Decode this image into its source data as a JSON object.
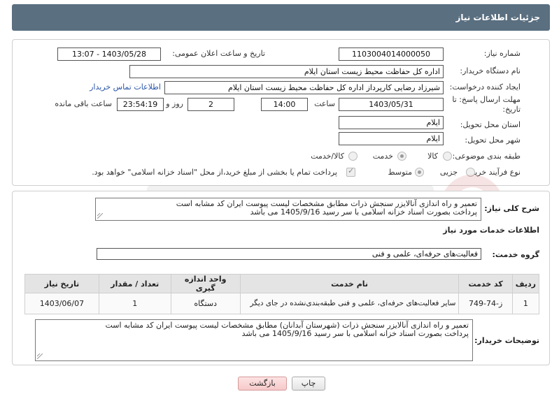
{
  "page": {
    "title": "جزئیات اطلاعات نیاز"
  },
  "form": {
    "need_number_label": "شماره نیاز:",
    "need_number": "1103004014000050",
    "announce_label": "تاریخ و ساعت اعلان عمومی:",
    "announce_value": "1403/05/28 - 13:07",
    "buyer_org_label": "نام دستگاه خریدار:",
    "buyer_org": "اداره کل حفاظت محیط زیست استان ایلام",
    "creator_label": "ایجاد کننده درخواست:",
    "creator": "شیرزاد رضایی کارپرداز اداره کل حفاظت محیط زیست استان ایلام",
    "contact_link": "اطلاعات تماس خریدار",
    "deadline_label": "مهلت ارسال پاسخ: تا تاریخ:",
    "deadline_date": "1403/05/31",
    "time_label": "ساعت",
    "deadline_time": "14:00",
    "days_value": "2",
    "days_label": "روز و",
    "remaining_time": "23:54:19",
    "remaining_label": "ساعت باقی مانده",
    "province_label": "استان محل تحویل:",
    "province": "ایلام",
    "city_label": "شهر محل تحویل:",
    "city": "ایلام",
    "category_label": "طبقه بندی موضوعی:",
    "category_options": [
      "کالا",
      "خدمت",
      "کالا/خدمت"
    ],
    "process_label": "نوع فرآیند خرید :",
    "process_options": [
      "جزیی",
      "متوسط"
    ],
    "payment_text": "پرداخت تمام یا بخشی از مبلغ خرید،از محل \"اسناد خزانه اسلامی\" خواهد بود."
  },
  "summary": {
    "label": "شرح کلی نیاز:",
    "line1": "تعمیر و راه اندازی آنالایزر سنجش ذرات مطابق مشخصات لیست پیوست ایران کد مشابه است",
    "line2": "پرداخت بصورت اسناد خزانه اسلامی با سر رسید 1405/9/16 می باشد"
  },
  "services": {
    "section_title": "اطلاعات خدمات مورد نیاز",
    "group_label": "گروه خدمت:",
    "group_value": "فعالیت‌های حرفه‌ای، علمی و فنی",
    "columns": [
      "ردیف",
      "کد خدمت",
      "نام خدمت",
      "واحد اندازه گیری",
      "تعداد / مقدار",
      "تاریخ نیاز"
    ],
    "rows": [
      {
        "row": "1",
        "code": "ز-74-749",
        "name": "سایر فعالیت‌های حرفه‌ای، علمی و فنی طبقه‌بندی‌نشده در جای دیگر",
        "unit": "دستگاه",
        "qty": "1",
        "date": "1403/06/07"
      }
    ]
  },
  "buyer_notes": {
    "label": "توضیحات خریدار:",
    "line1": "تعمیر و راه اندازی آنالایزر سنجش ذرات (شهرستان آبدانان)  مطابق مشخصات لیست پیوست ایران کد مشابه است",
    "line2": "پرداخت بصورت اسناد خزانه اسلامی با سر رسید 1405/9/16 می باشد"
  },
  "actions": {
    "print": "چاپ",
    "back": "بازگشت"
  },
  "colors": {
    "header_bg": "#5a6f80",
    "link": "#2a56a8",
    "back_button": "#f6c9c9"
  }
}
